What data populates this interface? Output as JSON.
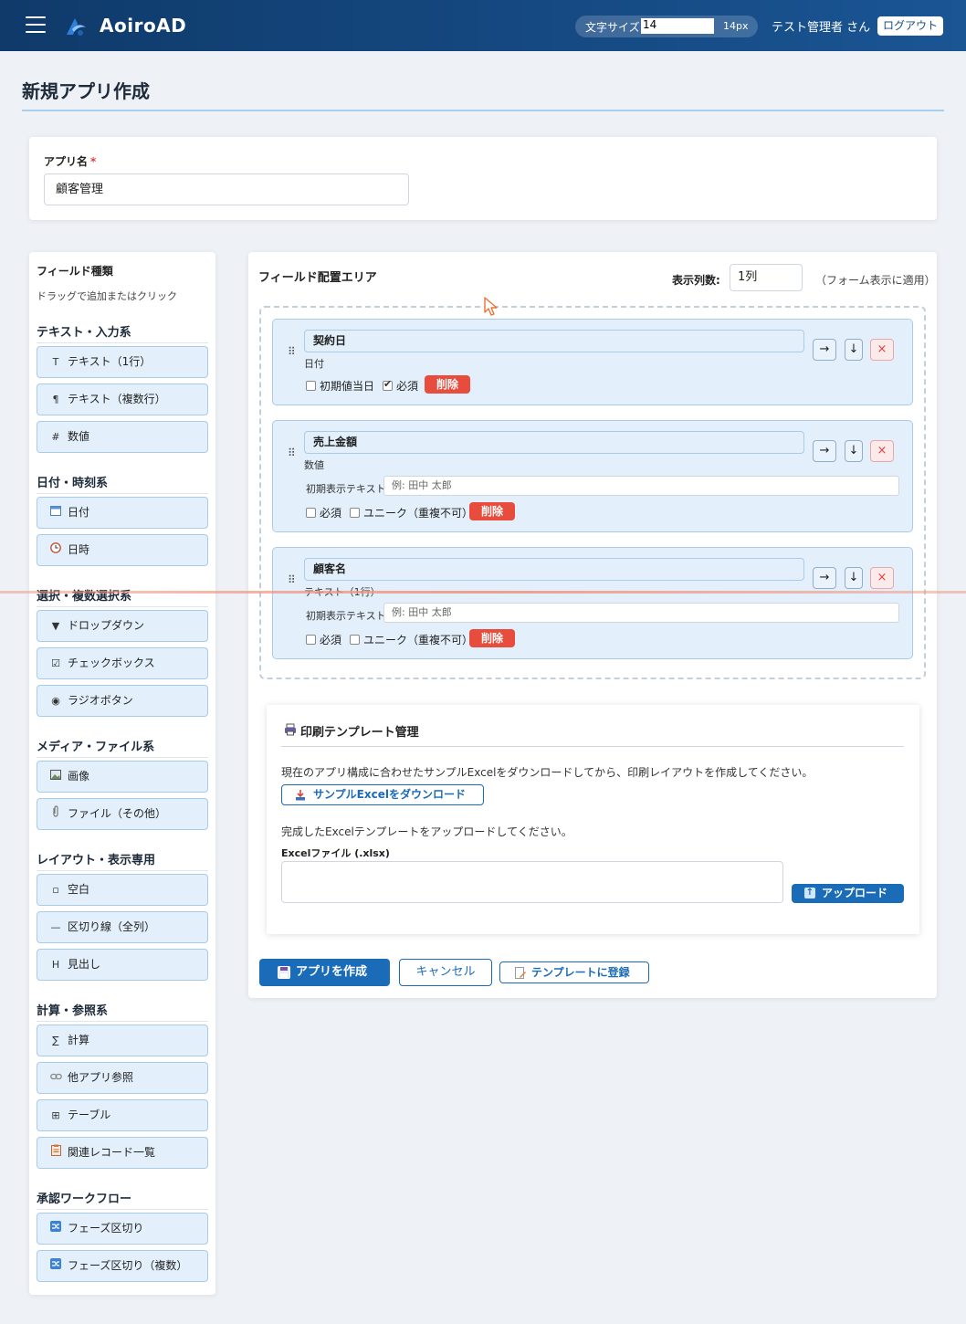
{
  "header": {
    "brand": "AoiroAD",
    "font_size_label": "文字サイズ",
    "font_size_input_value": "14",
    "font_size_display": "14px",
    "user_label": "テスト管理者 さん",
    "logout_label": "ログアウト"
  },
  "page": {
    "title": "新規アプリ作成"
  },
  "app_name": {
    "label": "アプリ名",
    "required_mark": "*",
    "value": "顧客管理"
  },
  "sidebar": {
    "title": "フィールド種類",
    "hint": "ドラッグで追加またはクリック",
    "categories": [
      {
        "label": "テキスト・入力系",
        "items": [
          {
            "icon": "T",
            "label": "テキスト（1行）"
          },
          {
            "icon": "¶",
            "label": "テキスト（複数行）"
          },
          {
            "icon": "#",
            "label": "数値"
          }
        ]
      },
      {
        "label": "日付・時刻系",
        "items": [
          {
            "icon": "calendar-icon",
            "label": "日付"
          },
          {
            "icon": "clock-icon",
            "label": "日時"
          }
        ]
      },
      {
        "label": "選択・複数選択系",
        "items": [
          {
            "icon": "▼",
            "label": "ドロップダウン"
          },
          {
            "icon": "☑",
            "label": "チェックボックス"
          },
          {
            "icon": "◉",
            "label": "ラジオボタン"
          }
        ]
      },
      {
        "label": "メディア・ファイル系",
        "items": [
          {
            "icon": "image-icon",
            "label": "画像"
          },
          {
            "icon": "paperclip-icon",
            "label": "ファイル（その他）"
          }
        ]
      },
      {
        "label": "レイアウト・表示専用",
        "items": [
          {
            "icon": "▫",
            "label": "空白"
          },
          {
            "icon": "—",
            "label": "区切り線（全列）"
          },
          {
            "icon": "H",
            "label": "見出し"
          }
        ]
      },
      {
        "label": "計算・参照系",
        "items": [
          {
            "icon": "∑",
            "label": "計算"
          },
          {
            "icon": "link-icon",
            "label": "他アプリ参照"
          },
          {
            "icon": "⊞",
            "label": "テーブル"
          },
          {
            "icon": "clipboard-icon",
            "label": "関連レコード一覧"
          }
        ]
      },
      {
        "label": "承認ワークフロー",
        "items": [
          {
            "icon": "shuffle-icon",
            "label": "フェーズ区切り"
          },
          {
            "icon": "shuffle-icon",
            "label": "フェーズ区切り（複数）"
          }
        ]
      }
    ]
  },
  "field_area": {
    "title": "フィールド配置エリア",
    "columns_label": "表示列数:",
    "columns_value": "1列",
    "columns_note": "（フォーム表示に適用）",
    "fields": [
      {
        "name": "契約日",
        "type": "日付",
        "options": [
          {
            "label": "初期値当日",
            "checked": false
          },
          {
            "label": "必須",
            "checked": true
          }
        ],
        "delete_label": "削除"
      },
      {
        "name": "売上金額",
        "type": "数値",
        "initial_text_label": "初期表示テキスト:",
        "initial_text_placeholder": "例: 田中 太郎",
        "options": [
          {
            "label": "必須",
            "checked": false
          },
          {
            "label": "ユニーク（重複不可）",
            "checked": false
          }
        ],
        "delete_label": "削除"
      },
      {
        "name": "顧客名",
        "type": "テキスト（1行）",
        "initial_text_label": "初期表示テキスト:",
        "initial_text_placeholder": "例: 田中 太郎",
        "options": [
          {
            "label": "必須",
            "checked": false
          },
          {
            "label": "ユニーク（重複不可）",
            "checked": false
          }
        ],
        "delete_label": "削除"
      }
    ],
    "controls": {
      "right": "→",
      "down": "↓",
      "remove": "×"
    }
  },
  "print_template": {
    "title": "印刷テンプレート管理",
    "description": "現在のアプリ構成に合わせたサンプルExcelをダウンロードしてから、印刷レイアウトを作成してください。",
    "download_label": "サンプルExcelをダウンロード",
    "upload_description": "完成したExcelテンプレートをアップロードしてください。",
    "file_label": "Excelファイル (.xlsx)",
    "upload_label": "アップロード"
  },
  "actions": {
    "create_label": "アプリを作成",
    "cancel_label": "キャンセル",
    "template_label": "テンプレートに登録"
  },
  "colors": {
    "header_start": "#0f3a6a",
    "header_end": "#1a5594",
    "accent": "#1a6bb8",
    "field_bg": "#e3f0fb",
    "danger": "#e74c3c"
  }
}
